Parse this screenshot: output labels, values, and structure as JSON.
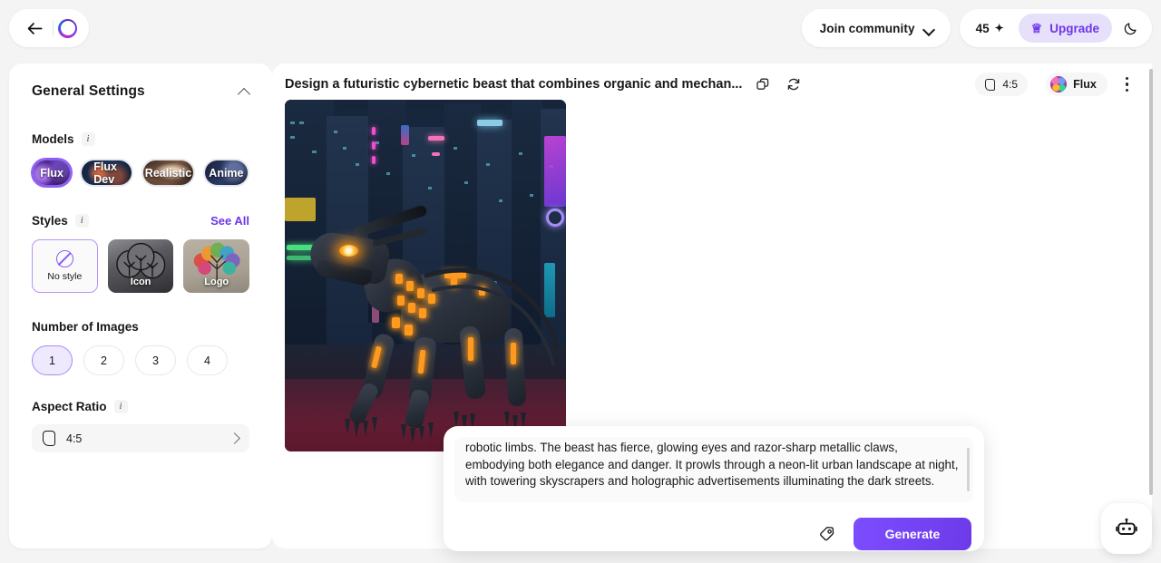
{
  "topbar": {
    "back_icon": "arrow-left-icon",
    "logo_icon": "ring-logo-icon",
    "join_community_label": "Join community",
    "chevron_icon": "chevron-down-icon",
    "credits_value": "45",
    "credits_icon": "sparkle-icon",
    "upgrade_label": "Upgrade",
    "upgrade_icon": "crown-icon",
    "theme_icon": "moon-icon"
  },
  "sidebar": {
    "section_title": "General Settings",
    "collapse_icon": "chevron-up-icon",
    "models": {
      "label": "Models",
      "info_icon": "info-icon",
      "items": [
        {
          "label": "Flux",
          "selected": true
        },
        {
          "label": "Flux Dev",
          "selected": false
        },
        {
          "label": "Realistic",
          "selected": false
        },
        {
          "label": "Anime",
          "selected": false
        }
      ]
    },
    "styles": {
      "label": "Styles",
      "info_icon": "info-icon",
      "see_all_label": "See All",
      "items": [
        {
          "label": "No style",
          "selected": true
        },
        {
          "label": "Icon",
          "selected": false
        },
        {
          "label": "Logo",
          "selected": false
        }
      ]
    },
    "number_of_images": {
      "label": "Number of Images",
      "options": [
        "1",
        "2",
        "3",
        "4"
      ],
      "selected": "1"
    },
    "aspect_ratio": {
      "label": "Aspect Ratio",
      "info_icon": "info-icon",
      "value": "4:5",
      "icon": "portrait-frame-icon",
      "chevron_icon": "chevron-right-icon"
    }
  },
  "main": {
    "prompt_title": "Design a futuristic cybernetic beast that combines organic and mechan...",
    "copy_icon": "copy-icon",
    "refresh_icon": "refresh-icon",
    "aspect_badge": {
      "value": "4:5",
      "icon": "portrait-frame-icon"
    },
    "model_badge": {
      "label": "Flux",
      "avatar": "flux-avatar-icon"
    },
    "more_icon": "kebab-menu-icon"
  },
  "prompt_box": {
    "text": "robotic limbs. The beast has fierce, glowing eyes and razor-sharp metallic claws, embodying both elegance and danger. It prowls through a neon-lit urban landscape at night, with towering skyscrapers and holographic advertisements illuminating the dark streets.",
    "tag_icon": "tag-icon",
    "generate_label": "Generate"
  },
  "fab": {
    "icon": "robot-icon"
  },
  "colors": {
    "accent": "#6d35e8",
    "accent_soft": "#e6e0fb",
    "panel": "#ffffff",
    "page_bg": "#f4f4f5",
    "text": "#18181b"
  }
}
